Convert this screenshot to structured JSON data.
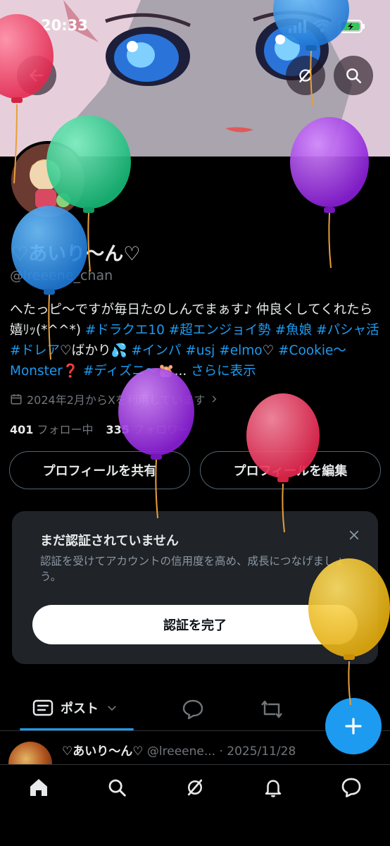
{
  "status_bar": {
    "time": "20:33"
  },
  "profile": {
    "display_name": "♡あいり〜ん♡",
    "handle": "@lreeene_chan",
    "bio_parts": [
      {
        "text": "へたっピ〜ですが毎日たのしんでまぁす♪ 仲良くしてくれたら嬉ﾘｯ(*^^*) ",
        "tag": false
      },
      {
        "text": "#ドラクエ10",
        "tag": true
      },
      {
        "text": " ",
        "tag": false
      },
      {
        "text": "#超エンジョイ勢",
        "tag": true
      },
      {
        "text": " ",
        "tag": false
      },
      {
        "text": "#魚娘",
        "tag": true
      },
      {
        "text": " ",
        "tag": false
      },
      {
        "text": "#パシャ活",
        "tag": true
      },
      {
        "text": " ",
        "tag": false
      },
      {
        "text": "#ドレア",
        "tag": true
      },
      {
        "text": "♡ばかり💦 ",
        "tag": false
      },
      {
        "text": "#インパ",
        "tag": true
      },
      {
        "text": " ",
        "tag": false
      },
      {
        "text": "#usj",
        "tag": true
      },
      {
        "text": " ",
        "tag": false
      },
      {
        "text": "#elmo",
        "tag": true
      },
      {
        "text": "♡ ",
        "tag": false
      },
      {
        "text": "#Cookie〜Monster",
        "tag": true
      },
      {
        "text": "❓ ",
        "tag": false
      },
      {
        "text": "#ディズニ〜",
        "tag": true
      },
      {
        "text": "🐹... ",
        "tag": false
      }
    ],
    "bio_more": "さらに表示",
    "joined": "2024年2月からXを利用しています",
    "following_count": "401",
    "following_label": "フォロー中",
    "followers_count": "335",
    "followers_label": "フォロワー"
  },
  "buttons": {
    "share_profile": "プロフィールを共有",
    "edit_profile": "プロフィールを編集"
  },
  "verify_card": {
    "title": "まだ認証されていません",
    "description": "認証を受けてアカウントの信用度を高め、成長につなげましょう。",
    "button": "認証を完了"
  },
  "tabs": {
    "posts": "ポスト"
  },
  "post": {
    "name": "♡あいり〜ん♡",
    "handle": "@lreeene...",
    "date": "· 2025/11/28"
  },
  "icons": [
    "back-arrow-icon",
    "grok-icon",
    "search-icon",
    "calendar-icon",
    "chevron-right-icon",
    "close-icon",
    "posts-tab-icon",
    "chevron-down-icon",
    "reply-icon",
    "repost-icon",
    "plus-icon",
    "home-icon",
    "notifications-icon",
    "messages-icon"
  ],
  "colors": {
    "accent": "#1d9bf0",
    "background": "#000000",
    "card": "#202327",
    "muted": "#71767b"
  }
}
